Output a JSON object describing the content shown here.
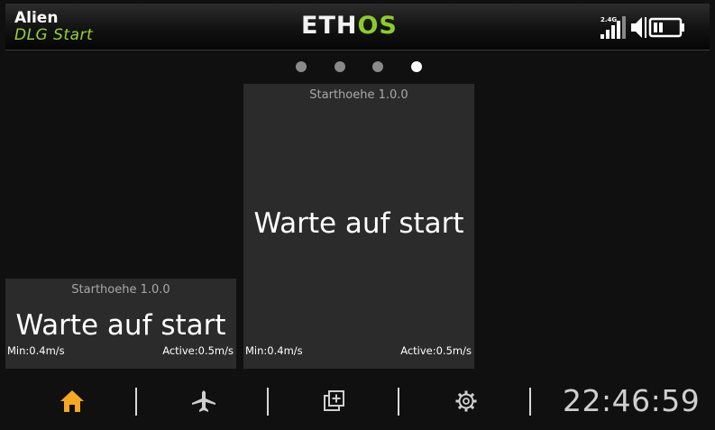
{
  "header": {
    "model_name": "Alien",
    "model_subtitle": "DLG Start",
    "logo_part1": "ETH",
    "logo_part2": "OS",
    "band_label": "2.4G"
  },
  "page_dots": {
    "count": 4,
    "active_index": 3
  },
  "widgets": [
    {
      "title": "Starthoehe 1.0.0",
      "message": "Warte auf start",
      "min_label": "Min:0.4m/s",
      "active_label": "Active:0.5m/s"
    },
    {
      "title": "Starthoehe 1.0.0",
      "message": "Warte auf start",
      "min_label": "Min:0.4m/s",
      "active_label": "Active:0.5m/s"
    }
  ],
  "bottom_bar": {
    "icons": [
      "home-icon",
      "airplane-icon",
      "layers-add-icon",
      "gear-icon"
    ],
    "active_icon": "home-icon",
    "clock": "22:46:59"
  },
  "colors": {
    "accent_green": "#8ccc2a",
    "subtitle_green": "#9bd22e",
    "home_orange": "#f5a623",
    "widget_bg": "#2b2b2b",
    "background": "#101010"
  }
}
